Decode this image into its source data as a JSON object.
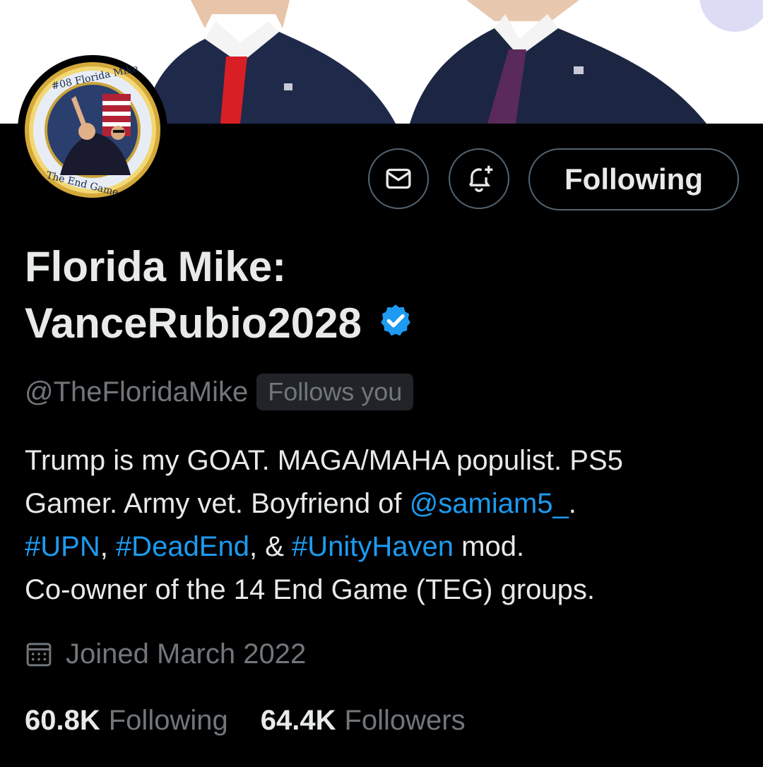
{
  "profile": {
    "name_line1": "Florida Mike:",
    "name_line2": "VanceRubio2028",
    "handle": "@TheFloridaMike",
    "follows_you": "Follows you",
    "verified_color": "#1d9bf0"
  },
  "avatar": {
    "ring_top_text": "#08 Florida Mike",
    "ring_bottom_text": "The End Game"
  },
  "actions": {
    "message_icon": "envelope-icon",
    "notify_icon": "bell-plus-icon",
    "following_label": "Following"
  },
  "bio": {
    "l1": "Trump is my GOAT. MAGA/MAHA populist. PS5",
    "l2_prefix": "Gamer. Army vet. Boyfriend of ",
    "l2_mention": "@samiam5_",
    "l2_suffix": ".",
    "l3_tag1": "#UPN",
    "l3_sep1": ", ",
    "l3_tag2": "#DeadEnd",
    "l3_sep2": ", & ",
    "l3_tag3": "#UnityHaven",
    "l3_suffix": " mod.",
    "l4": "Co-owner of the 14 End Game (TEG) groups."
  },
  "joined": {
    "icon": "calendar-icon",
    "text": "Joined March 2022"
  },
  "stats": {
    "following_count": "60.8K",
    "following_label": "Following",
    "followers_count": "64.4K",
    "followers_label": "Followers"
  },
  "colors": {
    "background": "#000000",
    "text": "#e7e9ea",
    "muted": "#71767b",
    "accent": "#1d9bf0",
    "border": "#536471"
  }
}
